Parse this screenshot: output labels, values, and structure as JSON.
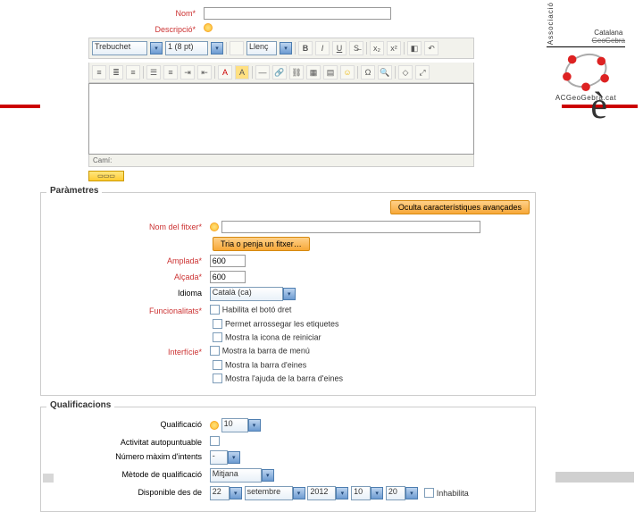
{
  "logo": {
    "assoc": "Associació",
    "catalana": "Catalana",
    "geogebra": "GeoGebra",
    "url": "ACGeoGebra.cat"
  },
  "bigchar": "è",
  "general": {
    "name_label": "Nom",
    "desc_label": "Descripció",
    "editor": {
      "font_family": "Trebuchet",
      "font_size": "1 (8 pt)",
      "lang": "Llenç",
      "path": "Camí:"
    }
  },
  "params": {
    "legend": "Paràmetres",
    "hide_advanced": "Oculta característiques avançades",
    "file_label": "Nom del fitxer",
    "upload_btn": "Tria o penja un fitxer…",
    "width_label": "Amplada",
    "width_value": "600",
    "height_label": "Alçada",
    "height_value": "600",
    "lang_label": "Idioma",
    "lang_value": "Català (ca)",
    "func_label": "Funcionalitats",
    "func_opts": [
      "Habilita el botó dret",
      "Permet arrossegar les etiquetes",
      "Mostra la icona de reiniciar"
    ],
    "iface_label": "Interfície",
    "iface_opts": [
      "Mostra la barra de menú",
      "Mostra la barra d'eines",
      "Mostra l'ajuda de la barra d'eines"
    ]
  },
  "grades": {
    "legend": "Qualificacions",
    "qual_label": "Qualificació",
    "qual_value": "10",
    "autograde_label": "Activitat autopuntuable",
    "attempts_label": "Número màxim d'intents",
    "attempts_value": "-",
    "method_label": "Mètode de qualificació",
    "method_value": "Mitjana",
    "avail_label": "Disponible des de",
    "day": "22",
    "month": "setembre",
    "year": "2012",
    "hour": "10",
    "minute": "20",
    "disable": "Inhabilita"
  }
}
